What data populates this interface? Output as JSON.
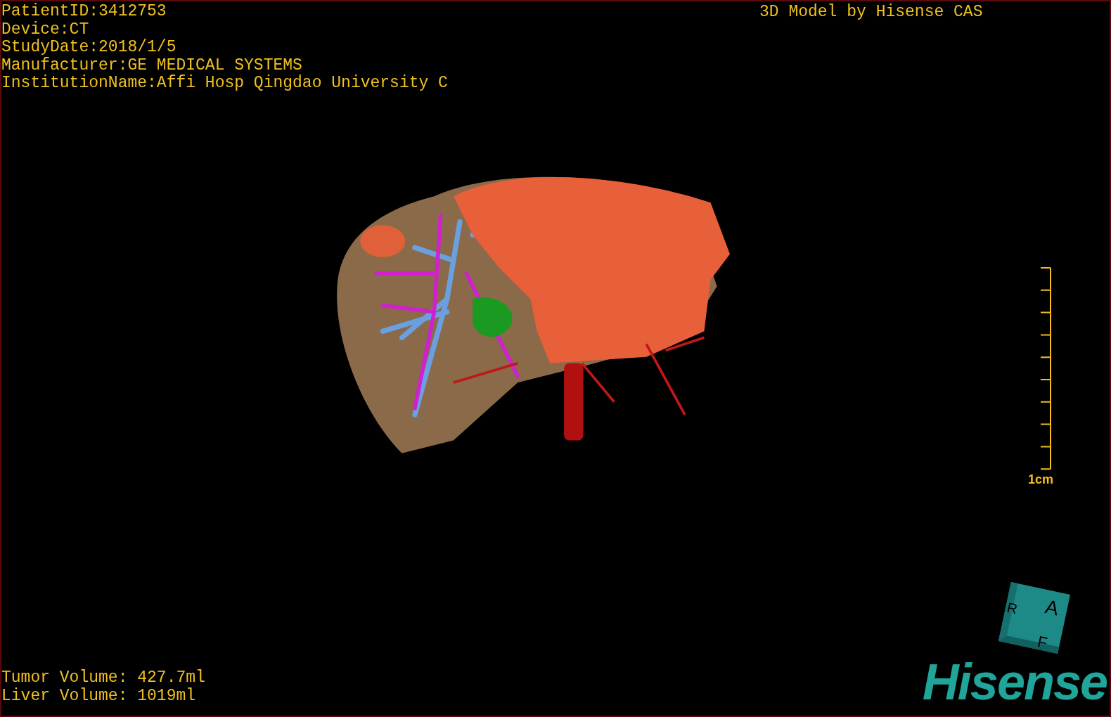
{
  "patient_info": [
    "PatientID:3412753",
    "Device:CT",
    "StudyDate:2018/1/5",
    "Manufacturer:GE MEDICAL SYSTEMS",
    "InstitutionName:Affi Hosp Qingdao University C"
  ],
  "credit": "3D Model by Hisense CAS",
  "scale_bar": {
    "label": "1cm"
  },
  "volumes": [
    "Tumor Volume: 427.7ml",
    "Liver Volume: 1019ml"
  ],
  "orientation_cube": {
    "front": "A",
    "left": "R",
    "bottom": "F"
  },
  "logo": "Hisense"
}
